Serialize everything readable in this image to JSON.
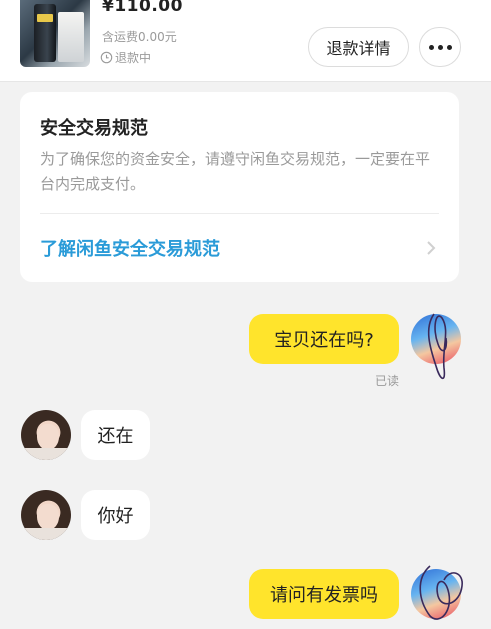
{
  "order": {
    "price": "¥110.00",
    "shipping": "含运费0.00元",
    "status": "退款中",
    "refund_button": "退款详情"
  },
  "safety_card": {
    "title": "安全交易规范",
    "text": "为了确保您的资金安全，请遵守闲鱼交易规范，一定要在平台内完成支付。",
    "link": "了解闲鱼安全交易规范"
  },
  "messages": [
    {
      "from": "me",
      "text": "宝贝还在吗?"
    },
    {
      "from": "them",
      "text": "还在"
    },
    {
      "from": "them",
      "text": "你好"
    },
    {
      "from": "me",
      "text": "请问有发票吗"
    }
  ],
  "read_status": "已读",
  "colors": {
    "my_bubble": "#ffe42c",
    "their_bubble": "#ffffff",
    "link": "#2a9bd8",
    "background": "#f2f2f2"
  },
  "icons": [
    "clock-icon",
    "more-dots-icon",
    "chevron-right-icon"
  ]
}
